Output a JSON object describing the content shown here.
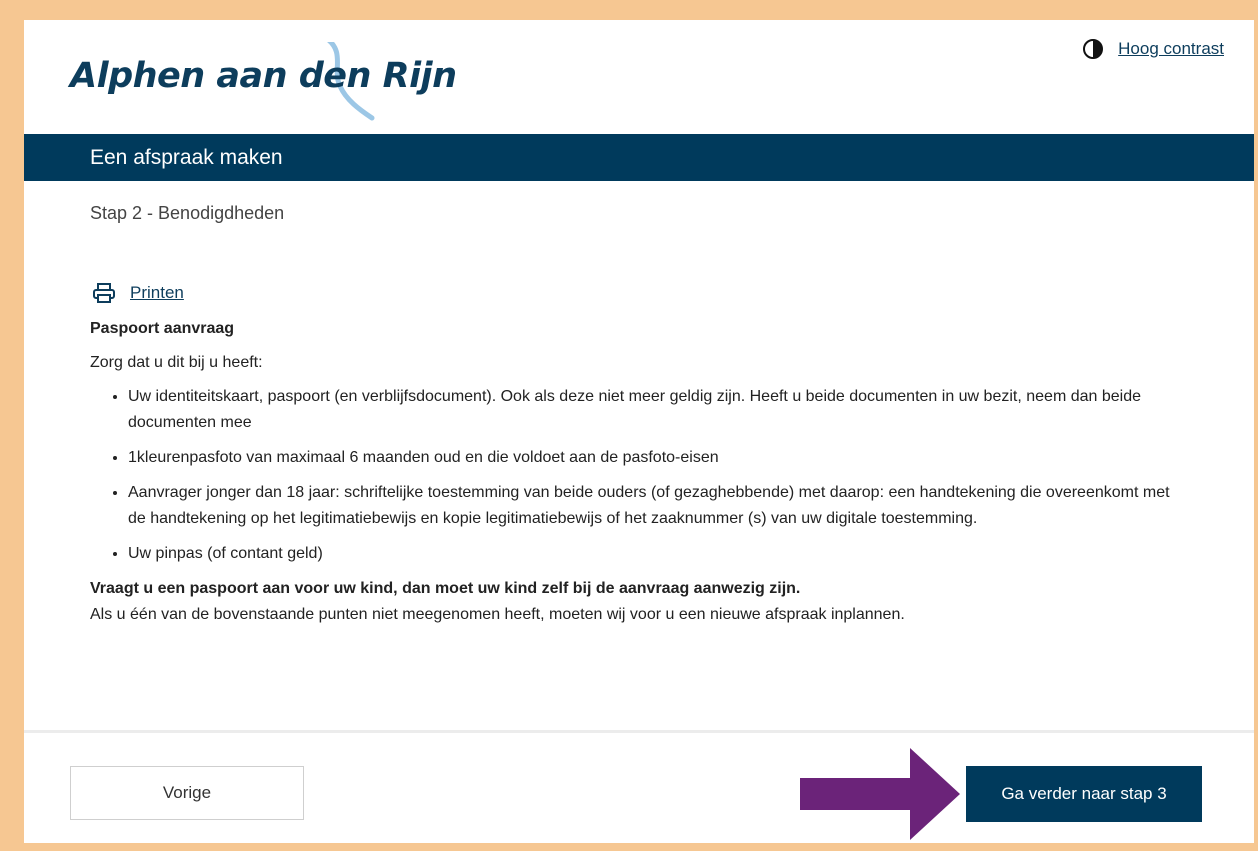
{
  "header": {
    "logo_text": "Alphen aan den Rijn",
    "contrast_label": "Hoog contrast"
  },
  "banner": {
    "title": "Een afspraak maken"
  },
  "step": {
    "label": "Stap 2 - Benodigdheden"
  },
  "content": {
    "print_label": "Printen",
    "section_title": "Paspoort aanvraag",
    "intro": "Zorg dat u dit bij u heeft:",
    "items": [
      "Uw identiteitskaart, paspoort (en verblijfsdocument). Ook als deze niet meer geldig zijn. Heeft u beide documenten in uw bezit, neem dan beide documenten mee",
      "1kleurenpasfoto van maximaal 6 maanden oud en die voldoet aan de pasfoto-eisen",
      "Aanvrager jonger dan 18 jaar: schriftelijke toestemming van beide ouders (of gezaghebbende) met daarop: een handtekening die overeenkomt met de handtekening op het legitimatiebewijs en kopie legitimatiebewijs of het zaaknummer (s) van uw digitale toestemming.",
      "Uw pinpas (of contant geld)"
    ],
    "note_bold": "Vraagt u een paspoort aan voor uw kind, dan moet uw kind zelf bij de aanvraag aanwezig zijn.",
    "note": "Als u één van de bovenstaande punten niet meegenomen heeft, moeten wij voor u een nieuwe afspraak inplannen."
  },
  "footer": {
    "prev_label": "Vorige",
    "next_label": "Ga verder naar stap 3"
  },
  "colors": {
    "brand_navy": "#003a5c",
    "page_border": "#f6c792",
    "arrow": "#6b2379",
    "logo_wave": "#9cc7e6"
  },
  "icons": {
    "contrast": "contrast-icon",
    "print": "printer-icon",
    "arrow": "arrow-right-icon"
  }
}
